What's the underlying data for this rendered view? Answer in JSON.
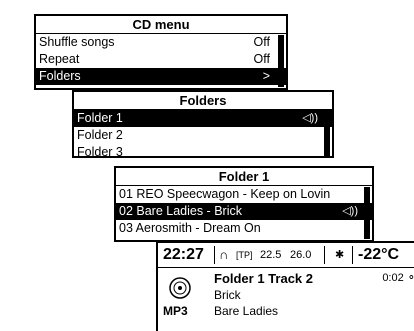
{
  "cd_menu": {
    "title": "CD menu",
    "items": [
      {
        "label": "Shuffle songs",
        "value": "Off"
      },
      {
        "label": "Repeat",
        "value": "Off"
      },
      {
        "label": "Folders",
        "value": ">"
      }
    ]
  },
  "folders_menu": {
    "title": "Folders",
    "items": [
      {
        "label": "Folder 1",
        "trail": "◁))"
      },
      {
        "label": "Folder 2"
      },
      {
        "label": "Folder 3"
      }
    ]
  },
  "folder1_menu": {
    "title": "Folder 1",
    "items": [
      {
        "label": "01 REO Speecwagon - Keep on Lovin"
      },
      {
        "label": "02 Bare Ladies - Brick",
        "trail": "◁))"
      },
      {
        "label": "03 Aerosmith - Dream On"
      }
    ]
  },
  "now_playing": {
    "status": {
      "clock": "22:27",
      "tp": "[TP]",
      "temp1": "22.5",
      "temp2": "26.0",
      "bluetooth": "✱",
      "outside_temp": "-22°C"
    },
    "format": "MP3",
    "track": "Folder 1 Track 2",
    "song": "Brick",
    "artist": "Bare Ladies",
    "time": "0:02 ⚬"
  }
}
